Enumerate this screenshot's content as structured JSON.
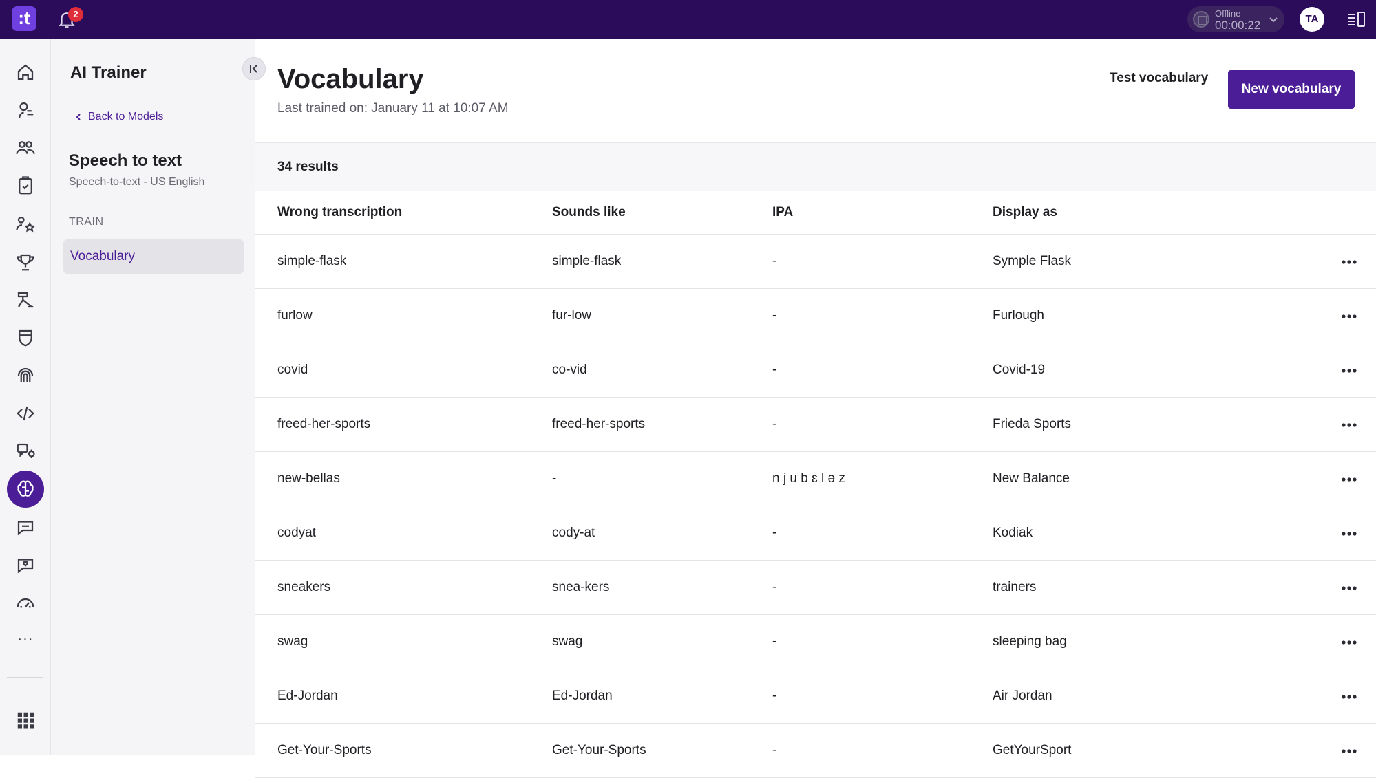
{
  "topbar": {
    "logo_text": ":t",
    "notifications_count": "2",
    "status_label": "Offline",
    "status_time": "00:00:22",
    "avatar_initials": "TA"
  },
  "rail": {
    "icons": [
      "home-icon",
      "chat-bot-icon",
      "contacts-icon",
      "clipboard-check-icon",
      "team-star-icon",
      "trophy-icon",
      "workflow-icon",
      "shield-icon",
      "fingerprint-icon",
      "code-icon",
      "speech-settings-icon",
      "ai-brain-icon",
      "speech-bubble-icon",
      "speech-bubble-heart-icon",
      "speedometer-icon"
    ],
    "active": "ai-brain-icon",
    "more_label": "···"
  },
  "sidebar": {
    "title": "AI Trainer",
    "back_label": "Back to Models",
    "model_name": "Speech to text",
    "model_sub": "Speech-to-text - US English",
    "section_label": "TRAIN",
    "active_item": "Vocabulary"
  },
  "main": {
    "title": "Vocabulary",
    "subtitle": "Last trained on: January 11 at 10:07 AM",
    "test_button": "Test vocabulary",
    "new_button": "New vocabulary",
    "results": "34 results",
    "columns": [
      "Wrong transcription",
      "Sounds like",
      "IPA",
      "Display as"
    ],
    "rows": [
      [
        "simple-flask",
        "simple-flask",
        "-",
        "Symple Flask"
      ],
      [
        "furlow",
        "fur-low",
        "-",
        "Furlough"
      ],
      [
        "covid",
        "co-vid",
        "-",
        "Covid-19"
      ],
      [
        "freed-her-sports",
        "freed-her-sports",
        "-",
        "Frieda Sports"
      ],
      [
        "new-bellas",
        "-",
        "n j u b ɛ l ə z",
        "New Balance"
      ],
      [
        "codyat",
        "cody-at",
        "-",
        "Kodiak"
      ],
      [
        "sneakers",
        "snea-kers",
        "-",
        "trainers"
      ],
      [
        "swag",
        "swag",
        "-",
        "sleeping bag"
      ],
      [
        "Ed-Jordan",
        "Ed-Jordan",
        "-",
        "Air Jordan"
      ],
      [
        "Get-Your-Sports",
        "Get-Your-Sports",
        "-",
        "GetYourSport"
      ]
    ]
  },
  "colors": {
    "topbar": "#2a0c5a",
    "brand": "#4b1d96",
    "logo": "#6f3fe0",
    "badge": "#e02d3c"
  }
}
